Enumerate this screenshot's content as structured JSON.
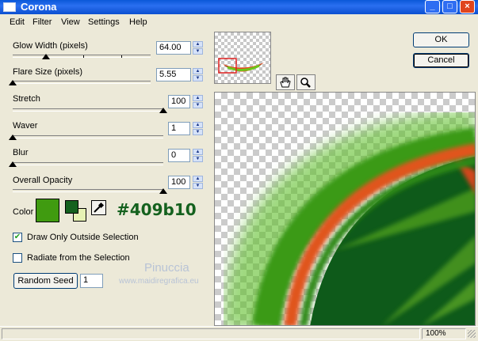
{
  "window": {
    "title": "Corona",
    "min_label": "_",
    "max_label": "□",
    "close_label": "×"
  },
  "menu": [
    "Edit",
    "Filter",
    "View",
    "Settings",
    "Help"
  ],
  "params": [
    {
      "label": "Glow Width (pixels)",
      "value": "64.00",
      "slider_fraction": 0.24
    },
    {
      "label": "Flare Size (pixels)",
      "value": "5.55",
      "slider_fraction": 0.0
    },
    {
      "label": "Stretch",
      "value": "100",
      "slider_fraction": 1.0
    },
    {
      "label": "Waver",
      "value": "1",
      "slider_fraction": 0.0
    },
    {
      "label": "Blur",
      "value": "0",
      "slider_fraction": 0.0
    },
    {
      "label": "Overall Opacity",
      "value": "100",
      "slider_fraction": 1.0
    }
  ],
  "color": {
    "label": "Color",
    "main": "#409b10",
    "secondary_dark": "#14611e",
    "secondary_light": "#e6f2b4",
    "hex_text": "#409b10"
  },
  "options": [
    {
      "label": "Draw Only Outside Selection",
      "checked": true
    },
    {
      "label": "Radiate from the Selection",
      "checked": false
    }
  ],
  "random_seed": {
    "label": "Random Seed",
    "value": "1"
  },
  "buttons": {
    "ok": "OK",
    "cancel": "Cancel"
  },
  "watermark": {
    "name": "Pinuccia",
    "site": "www.maidiregrafica.eu"
  },
  "status": {
    "zoom": "100%"
  }
}
